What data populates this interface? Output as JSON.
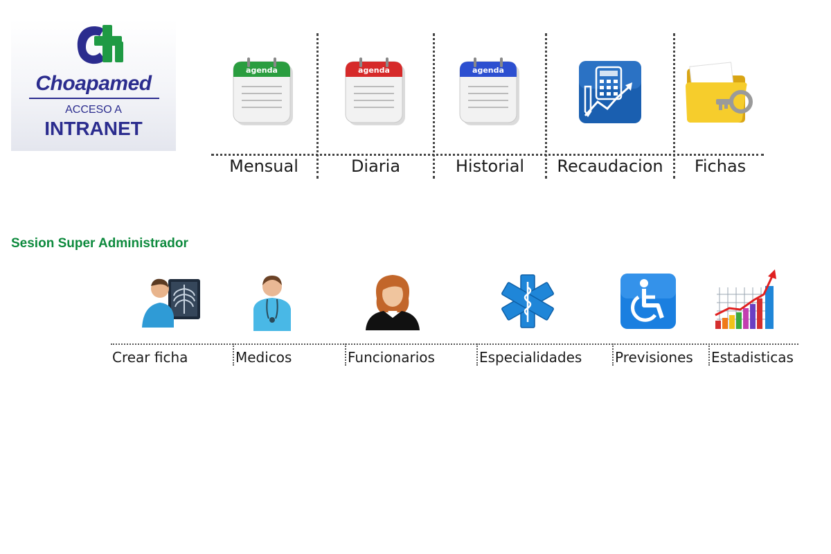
{
  "logo": {
    "brand": "Choapamed",
    "subtitle": "ACCESO A",
    "title": "INTRANET",
    "colors": {
      "blue": "#2b2c8e",
      "green": "#1f9a44"
    }
  },
  "top_menu": {
    "items": [
      {
        "label": "Mensual",
        "icon": "calendar-icon",
        "badge": "agenda",
        "color": "#2a9d3f"
      },
      {
        "label": "Diaria",
        "icon": "calendar-icon",
        "badge": "agenda",
        "color": "#d62a2a"
      },
      {
        "label": "Historial",
        "icon": "calendar-icon",
        "badge": "agenda",
        "color": "#2c4fd0"
      },
      {
        "label": "Recaudacion",
        "icon": "calculator-chart-icon",
        "color": "#1a5fb0"
      },
      {
        "label": "Fichas",
        "icon": "folder-key-icon",
        "color": "#f2c21b"
      }
    ]
  },
  "session": {
    "label": "Sesion Super Administrador",
    "color": "#0d8a3d"
  },
  "admin_menu": {
    "items": [
      {
        "label": "Crear ficha",
        "icon": "patient-xray-icon"
      },
      {
        "label": "Medicos",
        "icon": "doctor-icon"
      },
      {
        "label": "Funcionarios",
        "icon": "staff-woman-icon"
      },
      {
        "label": "Especialidades",
        "icon": "star-of-life-icon"
      },
      {
        "label": "Previsiones",
        "icon": "wheelchair-icon"
      },
      {
        "label": "Estadisticas",
        "icon": "bar-chart-icon"
      }
    ]
  }
}
